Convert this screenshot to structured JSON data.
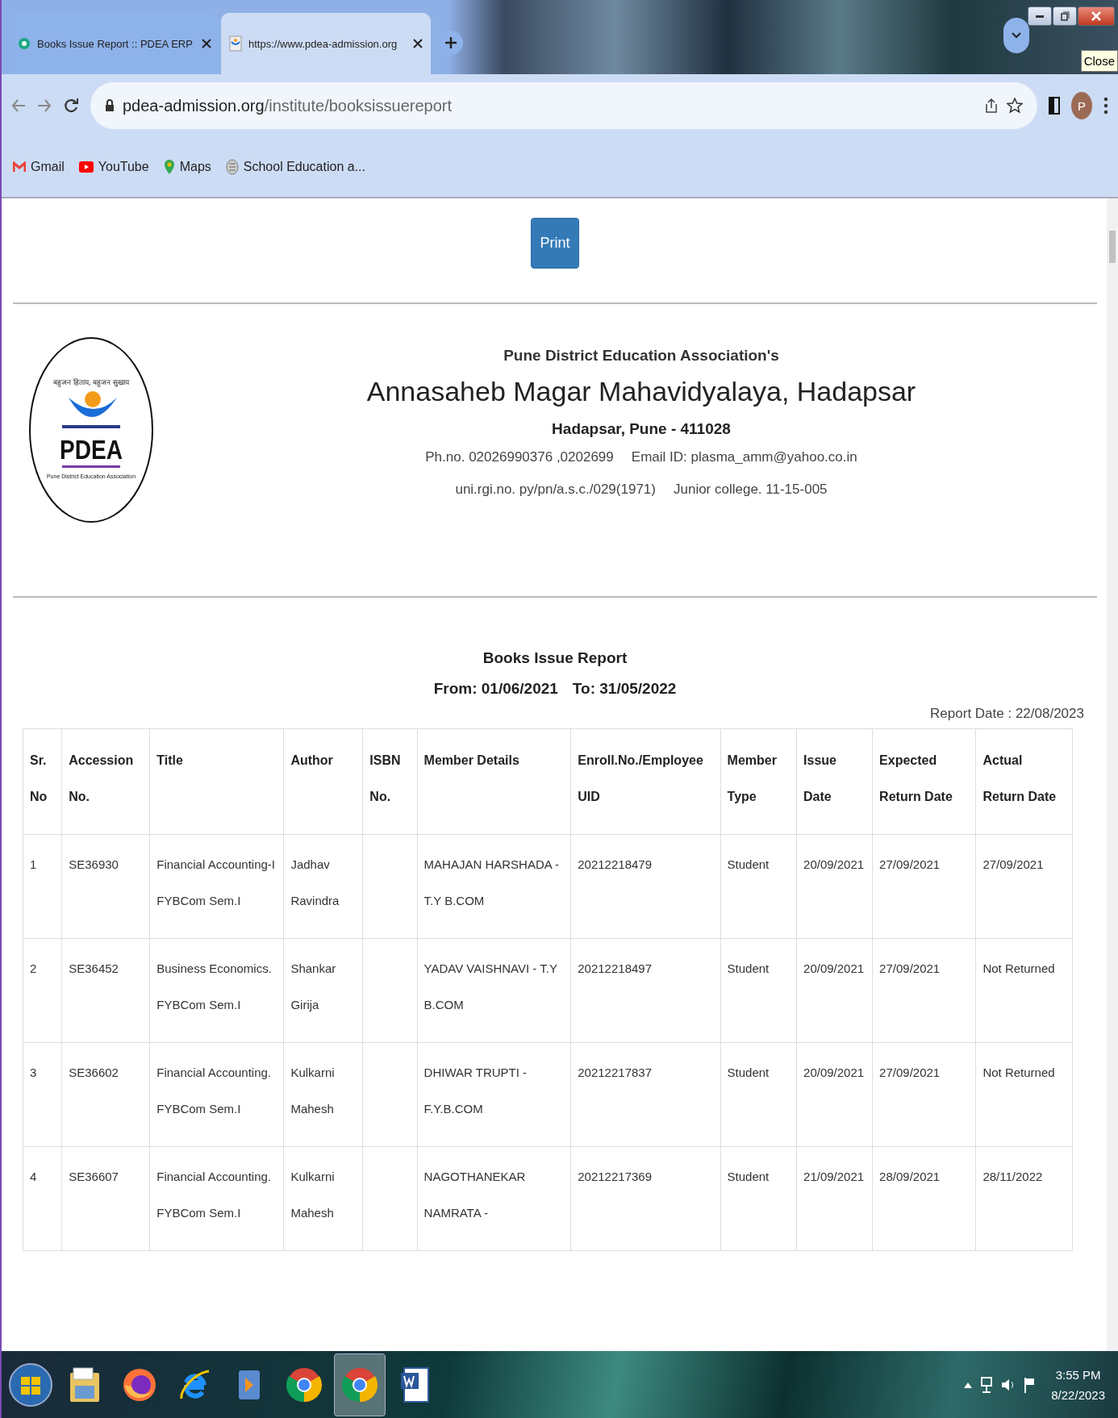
{
  "browser": {
    "tabs": [
      {
        "title": "Books Issue Report :: PDEA ERP",
        "kind": "circle",
        "selected": false
      },
      {
        "title": "https://www.pdea-admission.org",
        "kind": "logo",
        "selected": true
      }
    ],
    "tooltip": "Close",
    "address": {
      "domain": "pdea-admission.org",
      "path": "/institute/booksissuereport"
    },
    "profile_initial": "P",
    "bookmarks": [
      {
        "label": "Gmail",
        "kind": "mail"
      },
      {
        "label": "YouTube",
        "kind": "video"
      },
      {
        "label": "Maps",
        "kind": "pin"
      },
      {
        "label": "School Education a...",
        "kind": "site"
      }
    ]
  },
  "page": {
    "print_button": "Print",
    "header": {
      "logo": {
        "motto": "बहुजन हिताय, बहुजन सुखाय",
        "name": "PDEA",
        "subtitle": "Pune District Education Association"
      },
      "association": "Pune District Education Association's",
      "college": "Annasaheb Magar Mahavidyalaya, Hadapsar",
      "address": "Hadapsar, Pune - 411028",
      "phone": "Ph.no. 02026990376 ,0202699",
      "email": "Email ID: plasma_amm@yahoo.co.in",
      "registration": "uni.rgi.no. py/pn/a.s.c./029(1971)",
      "junior_college": "Junior college. 11-15-005"
    },
    "report": {
      "title": "Books Issue Report",
      "from": "From: 01/06/2021",
      "to": "To: 31/05/2022",
      "report_date": "Report Date : 22/08/2023"
    },
    "table": {
      "columns": [
        "Sr. No",
        "Accession No.",
        "Title",
        "Author",
        "ISBN No.",
        "Member Details",
        "Enroll.No./Employee UID",
        "Member Type",
        "Issue Date",
        "Expected Return Date",
        "Actual Return Date"
      ],
      "rows": [
        [
          "1",
          "SE36930",
          "Financial Accounting-I FYBCom Sem.I",
          "Jadhav Ravindra",
          "",
          "MAHAJAN HARSHADA - T.Y B.COM",
          "20212218479",
          "Student",
          "20/09/2021",
          "27/09/2021",
          "27/09/2021"
        ],
        [
          "2",
          "SE36452",
          "Business Economics. FYBCom Sem.I",
          "Shankar Girija",
          "",
          "YADAV VAISHNAVI - T.Y B.COM",
          "20212218497",
          "Student",
          "20/09/2021",
          "27/09/2021",
          "Not Returned"
        ],
        [
          "3",
          "SE36602",
          "Financial Accounting. FYBCom Sem.I",
          "Kulkarni Mahesh",
          "",
          "DHIWAR TRUPTI - F.Y.B.COM",
          "20212217837",
          "Student",
          "20/09/2021",
          "27/09/2021",
          "Not Returned"
        ],
        [
          "4",
          "SE36607",
          "Financial Accounting. FYBCom Sem.I",
          "Kulkarni Mahesh",
          "",
          "NAGOTHANEKAR NAMRATA -",
          "20212217369",
          "Student",
          "21/09/2021",
          "28/09/2021",
          "28/11/2022"
        ]
      ]
    }
  },
  "taskbar": {
    "apps": [
      {
        "kind": "folder",
        "selected": false
      },
      {
        "kind": "fox",
        "selected": false
      },
      {
        "kind": "e",
        "selected": false
      },
      {
        "kind": "media",
        "selected": false
      },
      {
        "kind": "chrome",
        "selected": false
      },
      {
        "kind": "chrome",
        "selected": true
      },
      {
        "kind": "doc",
        "selected": false
      }
    ],
    "time": "3:55 PM",
    "date": "8/22/2023"
  }
}
